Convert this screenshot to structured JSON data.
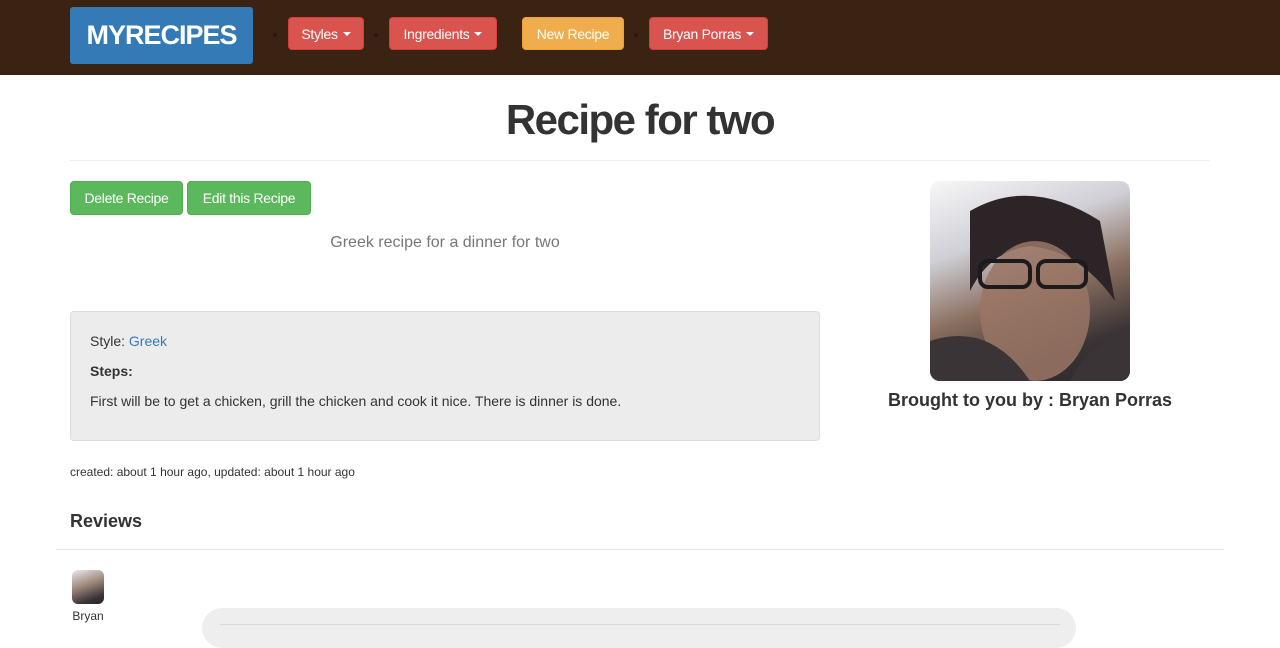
{
  "navbar": {
    "brand": "MYRECIPES",
    "styles_label": "Styles",
    "ingredients_label": "Ingredients",
    "new_recipe_label": "New Recipe",
    "user_label": "Bryan Porras",
    "colors": {
      "background": "#3b2314",
      "brand": "#337ab7",
      "danger": "#d9534f",
      "warning": "#f0ad4e"
    }
  },
  "recipe": {
    "title": "Recipe for two",
    "delete_label": "Delete Recipe",
    "edit_label": "Edit this Recipe",
    "description": "Greek recipe for a dinner for two",
    "style_label": "Style:",
    "style_value": "Greek",
    "steps_label": "Steps:",
    "steps_text": "First will be to get a chicken, grill the chicken and cook it nice. There is dinner is done.",
    "timestamps": "created: about 1 hour ago, updated: about 1 hour ago",
    "colors": {
      "success": "#5cb85c",
      "link": "#337ab7"
    }
  },
  "author": {
    "brought_by": "Brought to you by : Bryan Porras"
  },
  "reviews": {
    "title": "Reviews",
    "items": [
      {
        "user": "Bryan"
      }
    ]
  }
}
